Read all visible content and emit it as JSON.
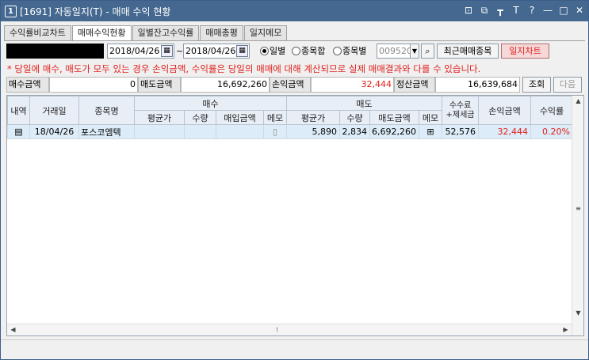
{
  "window": {
    "num": "1",
    "title": "[1691] 자동일지(T) - 매매 수익 현황"
  },
  "titlebar_icons": [
    "restore-icon",
    "copy-icon",
    "pin-icon",
    "font-icon",
    "help-icon",
    "minimize-icon",
    "maximize-icon",
    "close-icon"
  ],
  "titlebar_glyphs": [
    "⊡",
    "⧉",
    "┳",
    "T",
    "?",
    "—",
    "□",
    "✕"
  ],
  "tabs": [
    "수익률비교차트",
    "매매수익현황",
    "일별잔고수익률",
    "매매총평",
    "일지메모"
  ],
  "filter": {
    "date_from": "2018/04/26",
    "date_to": "2018/04/26",
    "tilde": "~",
    "radio_daily": "일별",
    "radio_sum": "종목합",
    "radio_each": "종목별",
    "code": "009520",
    "recent_btn": "최근매매종목",
    "chart_btn": "일지차트"
  },
  "notice": "* 당일에 매수, 매도가 모두 있는 경우 손익금액, 수익률은 당일의 매매에 대해 계산되므로 실제 매매결과와 다를 수 있습니다.",
  "summary": {
    "buy_label": "매수금액",
    "buy_value": "0",
    "sell_label": "매도금액",
    "sell_value": "16,692,260",
    "pl_label": "손익금액",
    "pl_value": "32,444",
    "settle_label": "정산금액",
    "settle_value": "16,639,684",
    "query_btn": "조회",
    "next_btn": "다음"
  },
  "grid": {
    "headers": {
      "detail": "내역",
      "date": "거래일",
      "name": "종목명",
      "buy": "매수",
      "sell": "매도",
      "fee": "수수료+제세금",
      "pl": "손익금액",
      "rate": "수익률"
    },
    "sub": {
      "avg": "평균가",
      "qty": "수량",
      "buy_amt": "매입금액",
      "memo": "메모",
      "sell_amt": "매도금액"
    },
    "rows": [
      {
        "date": "18/04/26",
        "name": "포스코엠텍",
        "buy_avg": "",
        "buy_qty": "",
        "buy_amt": "",
        "sell_avg": "5,890",
        "sell_qty": "2,834",
        "sell_amt": "6,692,260",
        "fee": "52,576",
        "pl": "32,444",
        "rate": "0.20%"
      }
    ]
  },
  "colors": {
    "title_bar": "#44688f",
    "loss_profit_red": "#e0201c",
    "row_highlight": "#dcecf8"
  }
}
